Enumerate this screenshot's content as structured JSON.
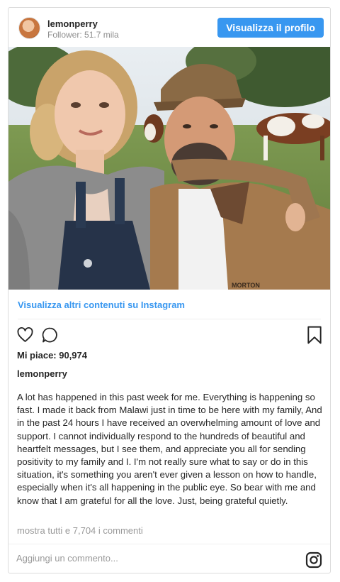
{
  "header": {
    "username": "lemonperry",
    "followers": "Follower: 51.7 mila",
    "profile_button": "Visualizza il profilo"
  },
  "post": {
    "more_link": "Visualizza altri contenuti su Instagram",
    "likes": "Mi piace: 90,974",
    "author": "lemonperry",
    "caption": "A lot has happened in this past week for me. Everything is happening so fast. I made it back from Malawi just in time to be here with my family, And in the past 24 hours I have received an overwhelming amount of love and support. I cannot individually respond to the hundreds of beautiful and heartfelt messages, but I see them, and appreciate you all for sending positivity to my family and I. I'm not really sure what to say or do in this situation, it's something you aren't ever given a lesson on how to handle, especially when it's all happening in the public eye. So bear with me and know that I am grateful for all the love. Just, being grateful quietly.",
    "comments_link": "mostra tutti e 7,704 i commenti"
  },
  "comment": {
    "placeholder": "Aggiungi un commento..."
  },
  "photo": {
    "jacket_text": "MORTON"
  },
  "icons": {
    "like": "heart-icon",
    "comment": "speech-bubble-icon",
    "save": "bookmark-icon",
    "instagram": "instagram-logo-icon"
  },
  "colors": {
    "accent": "#3897f0",
    "border": "#dbdbdb",
    "muted": "#999999"
  }
}
